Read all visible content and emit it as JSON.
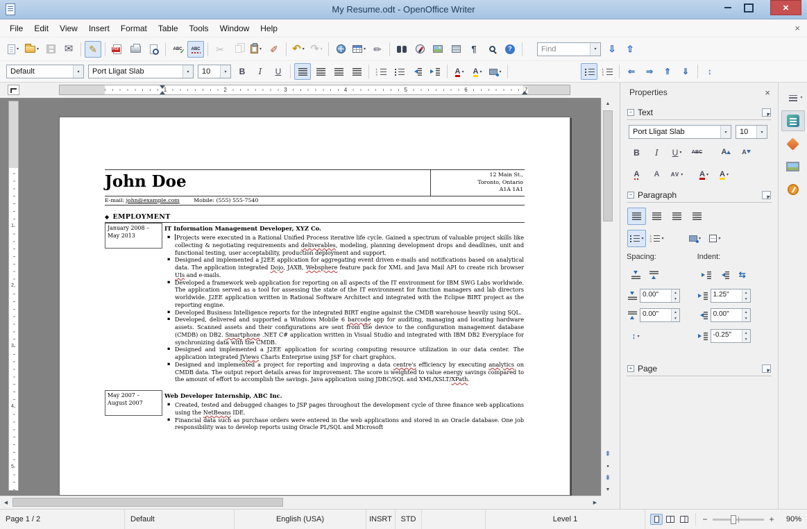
{
  "window": {
    "title": "My Resume.odt - OpenOffice Writer"
  },
  "menubar": {
    "items": [
      "File",
      "Edit",
      "View",
      "Insert",
      "Format",
      "Table",
      "Tools",
      "Window",
      "Help"
    ]
  },
  "std_toolbar": [
    {
      "name": "new-document",
      "kind": "page",
      "caret": true
    },
    {
      "name": "open",
      "kind": "folder",
      "caret": true
    },
    {
      "name": "save",
      "kind": "floppy",
      "disabled": true
    },
    {
      "name": "email-document",
      "glyph": "✉",
      "kind": "mail"
    },
    {
      "sep": true
    },
    {
      "name": "edit-file",
      "glyph": "✎",
      "kind": "editmode",
      "active": true
    },
    {
      "sep": true
    },
    {
      "name": "export-pdf",
      "kind": "pdf"
    },
    {
      "name": "print",
      "kind": "printer"
    },
    {
      "name": "page-preview",
      "kind": "preview"
    },
    {
      "sep": true
    },
    {
      "name": "spelling",
      "glyph": "ABC",
      "kind": "spell"
    },
    {
      "name": "autospellcheck",
      "glyph": "ABC",
      "kind": "autospell",
      "active": true
    },
    {
      "sep": true
    },
    {
      "name": "cut",
      "glyph": "✂",
      "kind": "cut",
      "disabled": true
    },
    {
      "name": "copy",
      "kind": "copy",
      "disabled": true
    },
    {
      "name": "paste",
      "kind": "paste",
      "caret": true
    },
    {
      "name": "clone-formatting",
      "glyph": "✐",
      "kind": "brush"
    },
    {
      "sep": true
    },
    {
      "name": "undo",
      "glyph": "↶",
      "kind": "undo",
      "caret": true
    },
    {
      "name": "redo",
      "glyph": "↷",
      "kind": "redo",
      "disabled": true,
      "caret": true
    },
    {
      "sep": true
    },
    {
      "name": "hyperlink",
      "kind": "globe"
    },
    {
      "name": "insert-table",
      "kind": "table",
      "caret": true
    },
    {
      "name": "draw-functions",
      "glyph": "✏",
      "kind": "draw"
    },
    {
      "sep": true
    },
    {
      "name": "find-replace",
      "kind": "binoc"
    },
    {
      "name": "navigator",
      "kind": "compass"
    },
    {
      "name": "gallery",
      "kind": "gallery"
    },
    {
      "name": "data-sources",
      "kind": "datasrc"
    },
    {
      "name": "formatting-marks",
      "glyph": "¶",
      "kind": "para"
    },
    {
      "name": "zoom",
      "kind": "mag"
    },
    {
      "name": "help",
      "glyph": "?",
      "kind": "help"
    },
    {
      "sep": true
    }
  ],
  "find_bar": {
    "value": "Find",
    "buttons": [
      {
        "name": "find-next",
        "glyph": "⇩",
        "cls": "s-findarrow"
      },
      {
        "name": "find-previous",
        "glyph": "⇧",
        "cls": "s-findarrow"
      }
    ]
  },
  "fmt_toolbar": {
    "style_combo": "Default",
    "font_combo": "Port Lligat Slab",
    "size_combo": "10",
    "buttons": [
      {
        "name": "bold",
        "glyph": "B",
        "cls": "s-bold"
      },
      {
        "name": "italic",
        "glyph": "I",
        "cls": "s-italic"
      },
      {
        "name": "underline",
        "glyph": "U",
        "cls": "s-under"
      },
      {
        "sep": true
      },
      {
        "name": "align-left",
        "kind": "lines",
        "active": true
      },
      {
        "name": "align-center",
        "kind": "lines"
      },
      {
        "name": "align-right",
        "kind": "lines"
      },
      {
        "name": "align-justify",
        "kind": "lines"
      },
      {
        "sep": true
      },
      {
        "name": "numbering-on-off",
        "kind": "numlist"
      },
      {
        "name": "bullets-on-off",
        "kind": "bullist"
      },
      {
        "name": "decrease-indent",
        "kind": "ind-dec"
      },
      {
        "name": "increase-indent",
        "kind": "ind-inc"
      },
      {
        "sep": true
      },
      {
        "name": "font-color",
        "glyph": "A",
        "cls": "s-fcolor",
        "caret": true
      },
      {
        "name": "highlighting",
        "glyph": "A",
        "cls": "s-hl",
        "caret": true
      },
      {
        "name": "background-color",
        "kind": "bgcolor",
        "caret": true
      },
      {
        "sep": true
      },
      {
        "spacer": 100
      },
      {
        "name": "list-bullets",
        "kind": "bullist",
        "active": true
      },
      {
        "name": "list-numbering",
        "kind": "numlist"
      },
      {
        "sep": true
      },
      {
        "name": "promote-level",
        "glyph": "⇐",
        "cls": "s-nav"
      },
      {
        "name": "demote-level",
        "glyph": "⇒",
        "cls": "s-nav"
      },
      {
        "name": "move-up",
        "glyph": "⇑",
        "cls": "s-nav"
      },
      {
        "name": "move-down",
        "glyph": "⇓",
        "cls": "s-nav"
      },
      {
        "sep": true
      },
      {
        "name": "restart-numbering",
        "glyph": "↕",
        "cls": "s-nav"
      }
    ]
  },
  "ruler": {
    "h_numbers": [
      "1",
      "2",
      "3",
      "4",
      "5",
      "6",
      "7"
    ],
    "v_numbers": [
      "1",
      "2",
      "3",
      "4",
      "5"
    ]
  },
  "document": {
    "name": "John Doe",
    "address": [
      "12 Main St.,",
      "Toronto, Ontario",
      "A1A 1A1"
    ],
    "email_label": "E-mail:",
    "email": "john@example.com",
    "mobile": "Mobile: (555) 555-7540",
    "section_bullet": "◆",
    "section_title": "EMPLOYMENT",
    "jobs": [
      {
        "dates": [
          "January 2008 –",
          "May 2013"
        ],
        "title": "IT Information Management Developer, XYZ Co.",
        "bullets": [
          [
            "Projects were executed in a Rational Unified Process iterative life cycle. Gained a spectrum of valuable project skills like collecting & negotiating requirements and ",
            [
              "deliverables",
              "u"
            ],
            ", modeling, planning development drops and deadlines, unit and functional testing, user acceptability, production deployment and support."
          ],
          [
            "Designed and implemented a J2EE application for aggregating event driven e-mails and notifications based on analytical data. The application integrated ",
            [
              "Dojo",
              "u"
            ],
            ", JAXB, ",
            [
              "Websphere",
              "u"
            ],
            " feature pack for XML and Java Mail API to create rich browser ",
            [
              "UIs",
              "u"
            ],
            " and e-mails."
          ],
          [
            "Developed a framework web application for reporting on all aspects of the IT environment for IBM SWG Labs worldwide. The application served as a tool for assessing the state of the IT environment for function managers and lab directors worldwide. J2EE application written in Rational Software Architect and integrated with the Eclipse BIRT project as the reporting engine."
          ],
          [
            "Developed Business Intelligence reports for the integrated BIRT engine against the CMDB warehouse heavily using SQL."
          ],
          [
            "Developed, delivered and supported a Windows Mobile 6 ",
            [
              "barcode",
              "u"
            ],
            " app for auditing, managing and locating hardware assets. Scanned assets and their configurations are sent from the device to the configuration management database (CMDB) on DB2. ",
            [
              "Smartphone",
              "u"
            ],
            " .NET C# application written in Visual Studio and integrated with IBM DB2 Everyplace for synchronizing data with the CMDB."
          ],
          [
            "Designed and implemented a J2EE application for scoring computing resource utilization in our data center. The application integrated ",
            [
              "JViews",
              "u"
            ],
            " Charts Enterprise using JSF for chart graphics."
          ],
          [
            "Designed and implemented a project for reporting and improving a data ",
            [
              "centre's",
              "u"
            ],
            " efficiency by executing ",
            [
              "analytics",
              "u"
            ],
            " on CMDB data. The output report details areas for improvement. The score is weighted to value energy savings compared to the amount of effort to accomplish the savings. Java application using JDBC/SQL and XML/XSLT/",
            [
              "XPath",
              "u"
            ],
            "."
          ]
        ]
      },
      {
        "dates": [
          "May 2007 –",
          "August 2007"
        ],
        "title": "Web Developer Internship, ABC Inc.",
        "bullets": [
          [
            "Created, tested and debugged changes to JSP pages throughout the development  cycle of three finance web applications using the ",
            [
              "NetBeans",
              "u"
            ],
            " IDE."
          ],
          [
            "Financial data such as purchase orders were entered in the web applications and stored in an Oracle database. One job responsibility was to develop reports using Oracle PL/SQL and Microsoft"
          ]
        ]
      }
    ]
  },
  "sidebar": {
    "title": "Properties",
    "text": {
      "title": "Text",
      "font_name": "Port Lligat Slab",
      "font_size": "10",
      "row1": [
        {
          "name": "bold",
          "glyph": "B",
          "cls": "s-bold"
        },
        {
          "name": "italic",
          "glyph": "I",
          "cls": "s-italic"
        },
        {
          "name": "underline",
          "glyph": "U",
          "cls": "s-under",
          "caret": true
        },
        {
          "name": "strikethrough",
          "glyph": "ABC",
          "cls": "s-strike"
        },
        {
          "spacer": 10
        },
        {
          "name": "increase-font-size",
          "glyph": "A",
          "cls": "s-inc"
        },
        {
          "name": "decrease-font-size",
          "glyph": "A",
          "cls": "s-dec"
        }
      ],
      "row2": [
        {
          "name": "font-effects",
          "glyph": "A",
          "cls": "s-fxwave"
        },
        {
          "name": "character-dialog",
          "glyph": "A",
          "cls": "s-fxpen"
        },
        {
          "name": "character-spacing",
          "glyph": "AV",
          "cls": "s-av",
          "caret": true
        },
        {
          "spacer": 10
        },
        {
          "name": "font-color",
          "glyph": "A",
          "cls": "s-fcolor",
          "caret": true
        },
        {
          "name": "highlighting",
          "glyph": "A",
          "cls": "s-hl",
          "caret": true
        }
      ]
    },
    "paragraph": {
      "title": "Paragraph",
      "row1": [
        {
          "name": "align-left",
          "kind": "lines",
          "active": true
        },
        {
          "name": "align-center",
          "kind": "lines"
        },
        {
          "name": "align-right",
          "kind": "lines"
        },
        {
          "name": "align-justify",
          "kind": "lines"
        }
      ],
      "row2": [
        {
          "name": "bullets",
          "kind": "bullist",
          "caret": true,
          "active": true
        },
        {
          "name": "numbering",
          "kind": "numlist",
          "caret": true
        },
        {
          "spacer": 26
        },
        {
          "name": "paragraph-background",
          "kind": "bgcolor",
          "caret": true
        },
        {
          "name": "borders",
          "kind": "borders",
          "caret": true
        }
      ],
      "spacing_label": "Spacing:",
      "indent_label": "Indent:",
      "spacing_buttons": [
        {
          "name": "increase-spacing",
          "kind": "sp-above"
        },
        {
          "name": "decrease-spacing",
          "kind": "sp-below"
        }
      ],
      "indent_buttons": [
        {
          "name": "increase-indent",
          "kind": "ind-inc"
        },
        {
          "name": "decrease-indent",
          "kind": "ind-dec"
        },
        {
          "name": "switch-indent",
          "glyph": "⇆",
          "cls": "s-nav"
        }
      ],
      "above_spacing": "0.00\"",
      "below_spacing": "0.00\"",
      "before_indent": "1.25\"",
      "after_indent": "0.00\"",
      "firstline_indent": "-0.25\""
    },
    "page": {
      "title": "Page"
    }
  },
  "sidebar_tabs": [
    {
      "name": "sidebar-settings",
      "kind": "decksettings"
    },
    {
      "name": "properties-deck",
      "kind": "deckprops",
      "active": true
    },
    {
      "name": "styles-deck",
      "kind": "deckstyles"
    },
    {
      "name": "gallery-deck",
      "kind": "deckgallery"
    },
    {
      "name": "navigator-deck",
      "kind": "decknav"
    }
  ],
  "statusbar": {
    "page": "Page 1 / 2",
    "style": "Default",
    "language": "English (USA)",
    "insert_mode": "INSRT",
    "selection_mode": "STD",
    "outline": "Level 1",
    "zoom": "90%"
  }
}
